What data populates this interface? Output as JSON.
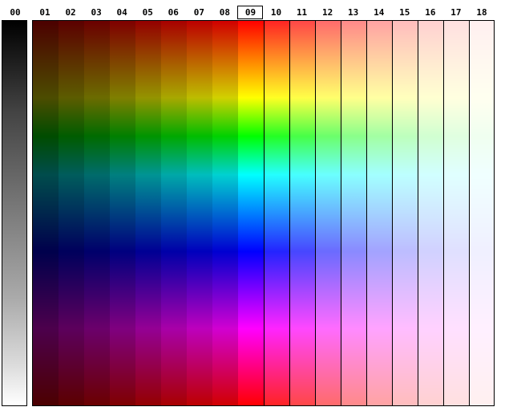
{
  "columns": {
    "grey_label": "00",
    "hue_labels": [
      "01",
      "02",
      "03",
      "04",
      "05",
      "06",
      "07",
      "08",
      "09",
      "10",
      "11",
      "12",
      "13",
      "14",
      "15",
      "16",
      "17",
      "18"
    ],
    "selected": "09"
  },
  "hue_stops": [
    "#ff0000",
    "#ff8000",
    "#ffff00",
    "#00ff00",
    "#00ffff",
    "#0080ff",
    "#0000ff",
    "#8000ff",
    "#ff00ff",
    "#ff0080",
    "#ff0000"
  ],
  "tint_levels": [
    0.3,
    0.36,
    0.42,
    0.5,
    0.58,
    0.66,
    0.74,
    0.82,
    1.0,
    0.14,
    0.28,
    0.42,
    0.54,
    0.64,
    0.74,
    0.82,
    0.88,
    0.94
  ],
  "colors": {
    "border": "#000000",
    "background": "#ffffff"
  }
}
